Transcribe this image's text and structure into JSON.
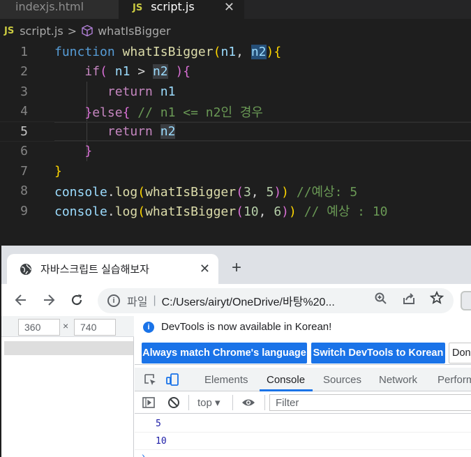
{
  "editor_tabs": [
    {
      "label": "indexjs.html"
    },
    {
      "label": "script.js",
      "close": "✕"
    }
  ],
  "file_badge": "JS",
  "breadcrumb": {
    "file": "script.js",
    "symbol": "whatIsBigger"
  },
  "code_lines": [
    {
      "num": "1"
    },
    {
      "num": "2"
    },
    {
      "num": "3"
    },
    {
      "num": "4"
    },
    {
      "num": "5"
    },
    {
      "num": "6"
    },
    {
      "num": "7"
    },
    {
      "num": "8"
    },
    {
      "num": "9"
    }
  ],
  "tokens": {
    "function": "function",
    "fname": "whatIsBigger",
    "n1": "n1",
    "n2": "n2",
    "if": "if",
    "return": "return",
    "else": "else",
    "comment4": "// n1 <= n2인 경우",
    "console": "console",
    "log": "log",
    "num3": "3",
    "num5": "5",
    "num10": "10",
    "num6": "6",
    "comment8": "//예상: 5",
    "comment9": "// 예상 : 10"
  },
  "browser": {
    "tab_title": "자바스크립트 실습해보자",
    "tab_close": "✕",
    "new_tab": "+",
    "site_label": "파일",
    "url": "C:/Users/airyt/OneDrive/바탕%20..."
  },
  "viewport": {
    "width": "360",
    "height": "740",
    "times": "×"
  },
  "devtools": {
    "notice": "DevTools is now available in Korean!",
    "btn_match": "Always match Chrome's language",
    "btn_switch": "Switch DevTools to Korean",
    "btn_dont": "Don't",
    "tabs": [
      "Elements",
      "Console",
      "Sources",
      "Network",
      "Perform"
    ],
    "context": "top",
    "filter_placeholder": "Filter",
    "console_output": [
      "5",
      "10"
    ]
  }
}
